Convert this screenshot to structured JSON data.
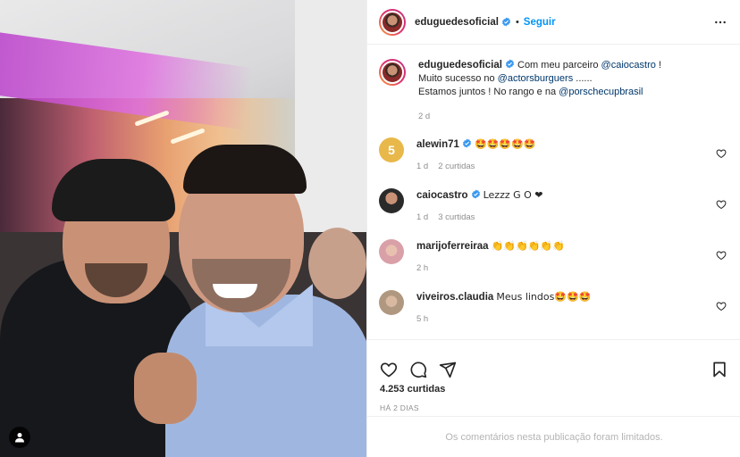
{
  "post": {
    "author": "eduguedesoficial",
    "follow_label": "Seguir",
    "separator": "•",
    "caption": {
      "username": "eduguedesoficial",
      "part1": "Com meu parceiro ",
      "mention1": "@caiocastro",
      "part2": " ! Muito sucesso no ",
      "mention2": "@actorsburguers",
      "part3": " ......",
      "part4": "Estamos juntos ! No rango e na ",
      "mention3": "@porschecupbrasil",
      "time": "2 d"
    },
    "comments": [
      {
        "username": "alewin71",
        "verified": true,
        "text": "🤩🤩🤩🤩🤩",
        "time": "1 d",
        "likes": "2 curtidas",
        "avatar_color": "#e8b84a"
      },
      {
        "username": "caiocastro",
        "verified": true,
        "text": "Lezzz G O ❤",
        "time": "1 d",
        "likes": "3 curtidas",
        "avatar_color": "#3a3a3a"
      },
      {
        "username": "marijoferreiraa",
        "verified": false,
        "text": "👏👏👏👏👏👏",
        "time": "2 h",
        "likes": "",
        "avatar_color": "#d9a0a8"
      },
      {
        "username": "viveiros.claudia",
        "verified": false,
        "text": "Meus lindos🤩🤩🤩",
        "time": "5 h",
        "likes": "",
        "avatar_color": "#c0a890"
      }
    ],
    "likes_count": "4.253 curtidas",
    "posted_ago": "HÁ 2 DIAS",
    "comments_limited": "Os comentários nesta publicação foram limitados."
  },
  "icons": [
    "more-icon",
    "verified-icon",
    "heart-icon",
    "comment-icon",
    "share-icon",
    "save-icon",
    "user-tag-icon"
  ],
  "colors": {
    "accent": "#0095f6",
    "verified": "#3897f0",
    "muted": "#8e8e8e",
    "mention": "#00376b"
  }
}
